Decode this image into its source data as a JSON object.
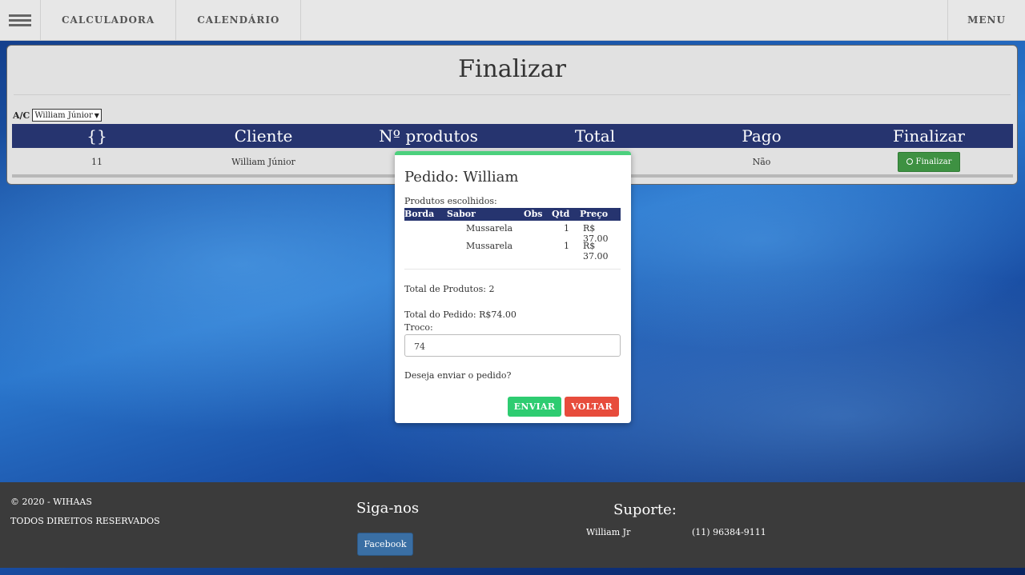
{
  "nav": {
    "items": [
      "CALCULADORA",
      "CALENDÁRIO"
    ],
    "menu_label": "MENU"
  },
  "panel": {
    "title": "Finalizar",
    "ac_label": "A/C",
    "ac_selected": "William Júnior",
    "table": {
      "headers": [
        "{}",
        "Cliente",
        "Nº produtos",
        "Total",
        "Pago",
        "Finalizar"
      ],
      "rows": [
        {
          "id": "11",
          "cliente": "William Júnior",
          "pago": "Não",
          "action": "Finalizar"
        }
      ]
    }
  },
  "modal": {
    "title": "Pedido: William",
    "subtitle": "Produtos escolhidos:",
    "headers": [
      "Borda",
      "Sabor",
      "Obs",
      "Qtd",
      "Preço"
    ],
    "items": [
      {
        "borda": "",
        "sabor": "Mussarela",
        "obs": "",
        "qtd": "1",
        "preco": "R$ 37.00"
      },
      {
        "borda": "",
        "sabor": "Mussarela",
        "obs": "",
        "qtd": "1",
        "preco": "R$ 37.00"
      }
    ],
    "total_produtos": "Total de Produtos: 2",
    "total_pedido": "Total do Pedido: R$74.00",
    "troco_label": "Troco:",
    "troco_value": "74",
    "question": "Deseja enviar o pedido?",
    "send_label": "ENVIAR",
    "back_label": "VOLTAR"
  },
  "footer": {
    "copyright": "© 2020 - WIHAAS",
    "rights": "TODOS DIREITOS RESERVADOS",
    "follow_title": "Siga-nos",
    "facebook_label": "Facebook",
    "support_title": "Suporte:",
    "support_name": "William Jr",
    "support_phone": "(11) 96384-9111"
  },
  "colors": {
    "table_header": "#26346f",
    "modal_accent": "#4cd07d",
    "send": "#2ecc71",
    "back": "#e74c3c",
    "finalizar_button": "#3e9142",
    "footer_bg": "#3b3b3b"
  }
}
